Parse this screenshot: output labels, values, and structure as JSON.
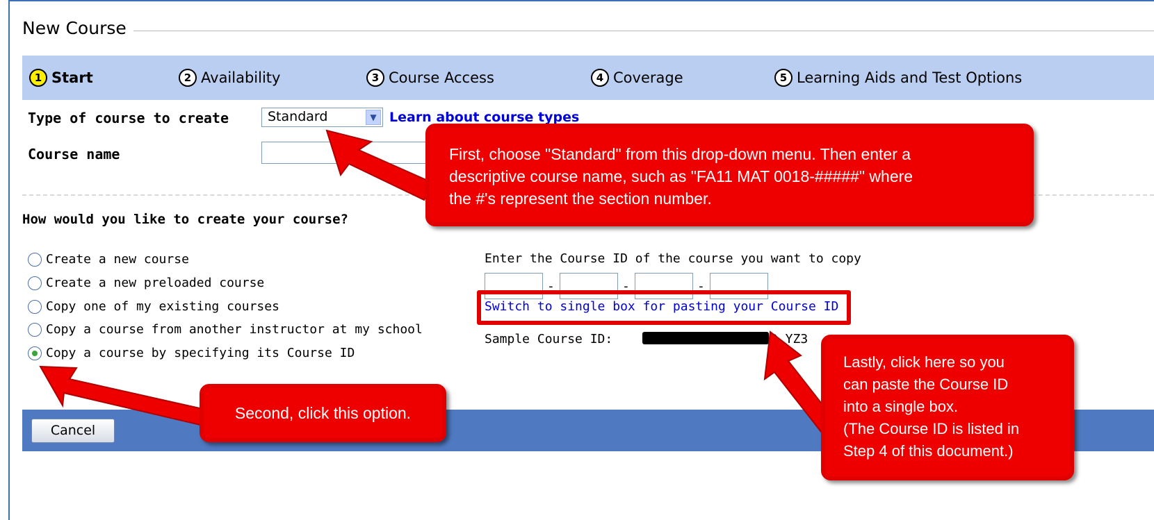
{
  "legend_title": "New Course",
  "wizard_steps": [
    {
      "number": "1",
      "label": "Start"
    },
    {
      "number": "2",
      "label": "Availability"
    },
    {
      "number": "3",
      "label": "Course Access"
    },
    {
      "number": "4",
      "label": "Coverage"
    },
    {
      "number": "5",
      "label": "Learning Aids and Test Options"
    }
  ],
  "form": {
    "type_label": "Type of course to create",
    "type_value": "Standard",
    "learn_link": "Learn about course types",
    "name_label": "Course name",
    "name_value": ""
  },
  "question": "How would you like to create your course?",
  "options": [
    {
      "label": "Create a new course",
      "checked": false
    },
    {
      "label": "Create a new preloaded course",
      "checked": false
    },
    {
      "label": "Copy one of my existing courses",
      "checked": false
    },
    {
      "label": "Copy a course from another instructor at my school",
      "checked": false
    },
    {
      "label": "Copy a course by specifying its Course ID",
      "checked": true
    }
  ],
  "course_id": {
    "prompt": "Enter the Course ID of the course you want to copy",
    "separator": "-",
    "switch_link": "Switch to single box for pasting your Course ID",
    "sample_label": "Sample Course ID:",
    "sample_visible_end": "D  YZ3"
  },
  "cancel_label": "Cancel",
  "callouts": {
    "first": [
      "First, choose \"Standard\" from this drop-down menu.  Then enter a",
      "descriptive course name, such as \"FA11 MAT 0018-#####\" where",
      "the #'s represent the section number."
    ],
    "second": "Second, click this option.",
    "last": [
      "Lastly, click here so you",
      "can paste the Course ID",
      "into a single box.",
      "(The Course ID is listed in",
      "Step 4 of this document.)"
    ]
  },
  "colors": {
    "wizard_bg": "#b9cef0",
    "active_step_circle": "#ffee00",
    "button_bar": "#4f79c1",
    "callout_red": "#ee0000",
    "link_blue": "#0000dd"
  }
}
